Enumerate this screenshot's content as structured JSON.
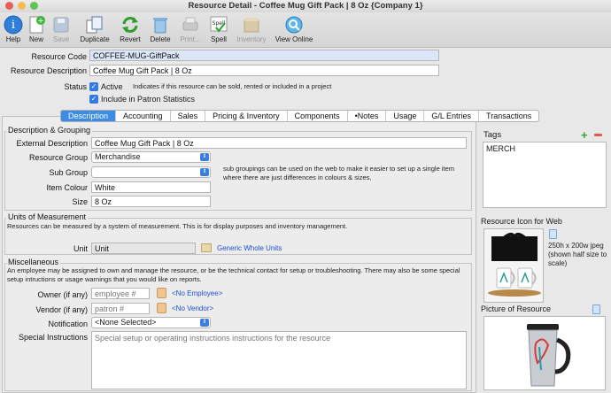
{
  "window": {
    "title": "Resource Detail - Coffee Mug Gift Pack | 8 Oz {Company 1}"
  },
  "toolbar": {
    "help": "Help",
    "new": "New",
    "save": "Save",
    "duplicate": "Duplicate",
    "revert": "Revert",
    "delete": "Delete",
    "print": "Print...",
    "spell": "Spell",
    "inventory": "Inventory",
    "view_online": "View Online",
    "spell_glyph": "Spell"
  },
  "header": {
    "resource_code_label": "Resource Code",
    "resource_code": "COFFEE-MUG-GiftPack",
    "resource_description_label": "Resource Description",
    "resource_description": "Coffee Mug Gift Pack | 8 Oz",
    "status_label": "Status",
    "active_label": "Active",
    "active_note": "Indicates if this resource can be sold, rented or included in a project",
    "patron_stats_label": "Include in Patron Statistics"
  },
  "tabs": [
    "Description",
    "Accounting",
    "Sales",
    "Pricing & Inventory",
    "Components",
    "•Notes",
    "Usage",
    "G/L Entries",
    "Transactions"
  ],
  "description": {
    "group_title": "Description & Grouping",
    "external_description_label": "External Description",
    "external_description": "Coffee Mug Gift Pack | 8 Oz",
    "resource_group_label": "Resource Group",
    "resource_group": "Merchandise",
    "sub_group_label": "Sub Group",
    "sub_group": "",
    "sub_group_note": "sub groupings can be used on the web to make it easier to set up a single item where there are just differences in colours & sizes,",
    "item_colour_label": "Item Colour",
    "item_colour": "White",
    "size_label": "Size",
    "size": "8 Oz"
  },
  "units": {
    "group_title": "Units of Measurement",
    "note": "Resources can be measured by a system of measurement.  This is for display purposes and inventory management.",
    "unit_label": "Unit",
    "unit": "Unit",
    "unit_link": "Generic Whole Units"
  },
  "misc": {
    "group_title": "Miscellaneous",
    "note": "An employee may be assigned to own and manage the resource, or be the technical contact for setup or troubleshooting.  There may also be some special setup intructions or usage warnings that you would like on reports.",
    "owner_label": "Owner (if any)",
    "owner_placeholder": "employee #",
    "owner_link": "<No Employee>",
    "vendor_label": "Vendor (if any)",
    "vendor_placeholder": "patron #",
    "vendor_link": "<No Vendor>",
    "notification_label": "Notification",
    "notification": "<None Selected>",
    "special_label": "Special Instructions",
    "special_placeholder": "Special setup or operating instructions instructions for the resource"
  },
  "side": {
    "tags_label": "Tags",
    "tags": [
      "MERCH"
    ],
    "icon_label": "Resource Icon for Web",
    "icon_note": "250h x 200w jpeg (shown half size to scale)",
    "picture_label": "Picture of Resource"
  },
  "colors": {
    "accent": "#3c8be5",
    "link": "#1d4fd0",
    "add": "#2fa52f",
    "remove": "#e05a4a"
  }
}
